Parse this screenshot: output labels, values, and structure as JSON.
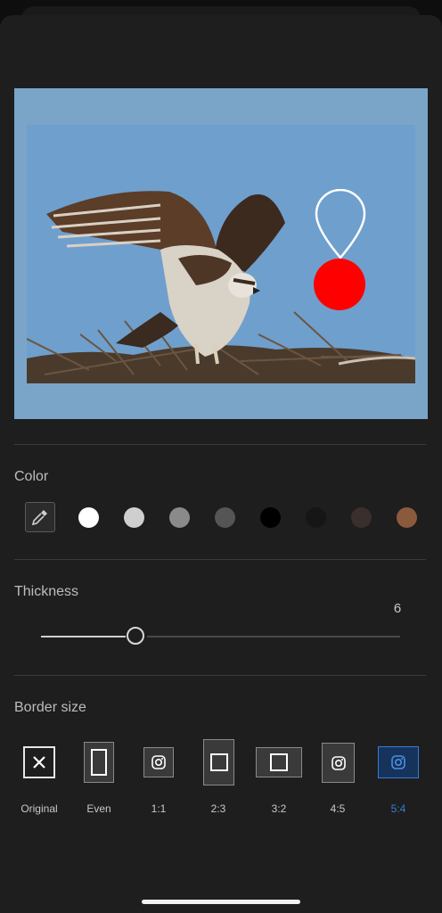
{
  "color_section": {
    "title": "Color",
    "swatches": [
      "#ffffff",
      "#cfcfcf",
      "#8a8a8a",
      "#555555",
      "#000000",
      "#161616",
      "#3a2f2d",
      "#8b5a3c"
    ]
  },
  "thickness_section": {
    "title": "Thickness",
    "value": "6",
    "slider_fraction": 0.27
  },
  "border_section": {
    "title": "Border size",
    "options": [
      {
        "label": "Original",
        "icon": "close-icon"
      },
      {
        "label": "Even",
        "icon": "rectangle-icon"
      },
      {
        "label": "1:1",
        "icon": "instagram-icon"
      },
      {
        "label": "2:3",
        "icon": "square-icon"
      },
      {
        "label": "3:2",
        "icon": "square-icon"
      },
      {
        "label": "4:5",
        "icon": "instagram-icon"
      },
      {
        "label": "5:4",
        "icon": "instagram-icon"
      }
    ],
    "selected": "5:4",
    "accent_color": "#3a7bd5"
  },
  "preview": {
    "border_color": "#7aa5c9",
    "pin_color": "#ff0000"
  }
}
